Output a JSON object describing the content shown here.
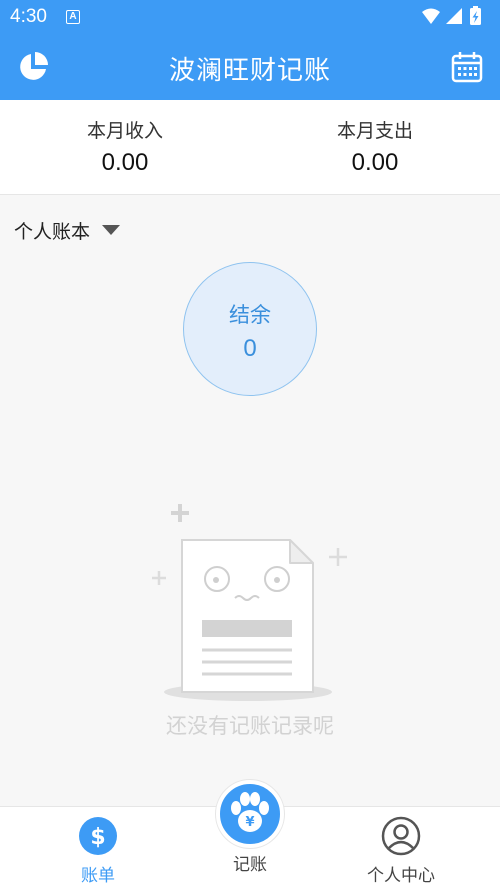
{
  "status_bar": {
    "time": "4:30",
    "notification_icon": "A",
    "icons": [
      "wifi-icon",
      "cell-signal-icon",
      "battery-charging-icon"
    ]
  },
  "app_bar": {
    "title": "波澜旺财记账",
    "left_icon": "pie-chart-icon",
    "right_icon": "calendar-icon"
  },
  "summary": {
    "income_label": "本月收入",
    "income_value": "0.00",
    "expense_label": "本月支出",
    "expense_value": "0.00"
  },
  "book_selector": {
    "label": "个人账本"
  },
  "balance": {
    "label": "结余",
    "value": "0"
  },
  "empty_state": {
    "text": "还没有记账记录呢"
  },
  "tab_bar": {
    "tabs": [
      {
        "label": "账单",
        "icon": "dollar-circle-icon",
        "active": true
      },
      {
        "label": "记账",
        "icon": "paw-yen-icon",
        "active": false
      },
      {
        "label": "个人中心",
        "icon": "user-circle-icon",
        "active": false
      }
    ]
  },
  "colors": {
    "primary": "#3d9bf5",
    "balance_fill": "#e3eefb",
    "balance_border": "#8fc3ef",
    "empty_text": "#d2d2d2"
  }
}
